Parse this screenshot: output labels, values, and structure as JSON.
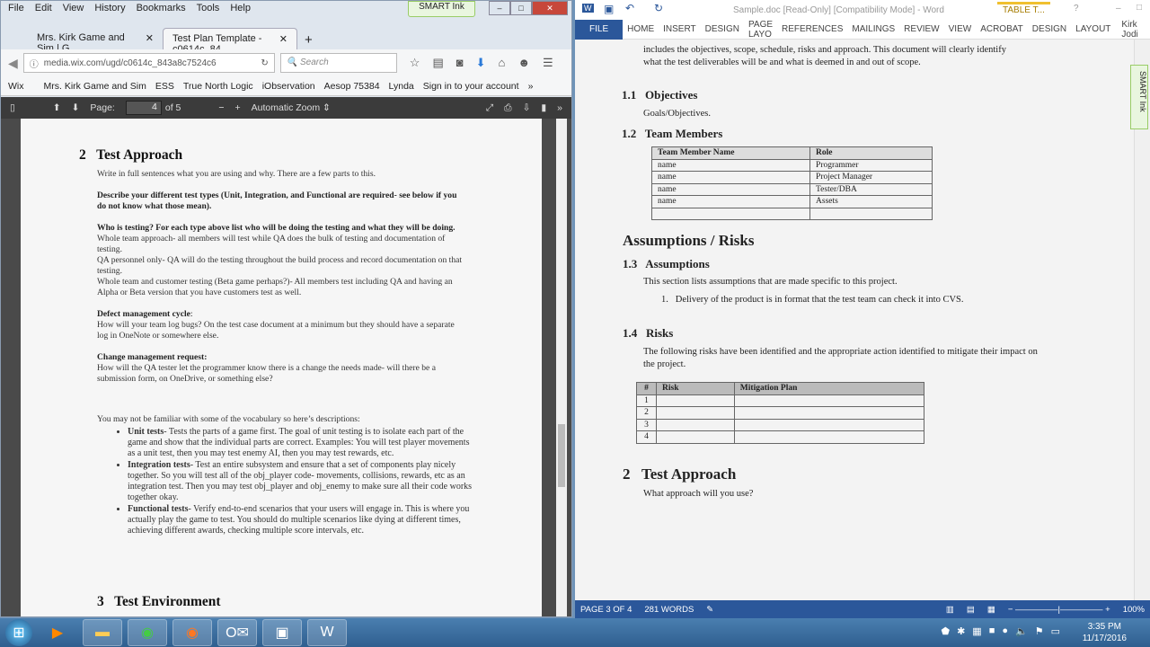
{
  "firefox": {
    "menu": [
      "File",
      "Edit",
      "View",
      "History",
      "Bookmarks",
      "Tools",
      "Help"
    ],
    "smart_ink": "SMART Ink",
    "tabs": [
      {
        "label": "Mrs. Kirk Game and Sim | G..."
      },
      {
        "label": "Test Plan Template - c0614c_84..."
      }
    ],
    "url": "media.wix.com/ugd/c0614c_843a8c7524c6",
    "search_placeholder": "Search",
    "bookmarks": [
      "Wix",
      "Mrs. Kirk Game and Sim",
      "ESS",
      "True North Logic",
      "iObservation",
      "Aesop 75384",
      "Lynda",
      "Sign in to your account"
    ],
    "pdf": {
      "page_label": "Page:",
      "page": "4",
      "of": "of 5",
      "zoom": "Automatic Zoom"
    },
    "doc": {
      "h_num": "2",
      "h_title": "Test Approach",
      "p1": "Write in full sentences what you are using and why.  There are a few parts to this.",
      "p2": "Describe your different test types (Unit, Integration, and Functional are required- see below if you do not know what those mean).",
      "p3b": "Who is testing?  For each type above list who will be doing the testing and what they will be doing.",
      "p3a": "Whole team approach- all members will test while QA does the bulk of testing and documentation of testing.",
      "p3c": "QA personnel only- QA will do the testing throughout the build process and record documentation on that testing.",
      "p3d": "Whole team and customer testing (Beta game perhaps?)- All members test including QA and having an Alpha or Beta version that you have customers test as well.",
      "p4b": "Defect management cycle",
      "p4": "How will your team log bugs?  On the test case document at a minimum but they should have a separate log in OneNote or somewhere else.",
      "p5b": "Change management request:",
      "p5": "How will the QA tester let the programmer know there is a change the needs made- will there be a submission form, on OneDrive, or something else?",
      "p6": "You may not be familiar with some of the vocabulary so here’s descriptions:",
      "bullets": [
        {
          "term": "Unit tests",
          "text": "- Tests the parts of a game first. The goal of unit testing is to isolate each part of the game and show that the individual parts are correct.  Examples: You will test player movements as a unit test, then you may test enemy AI, then you may test rewards, etc."
        },
        {
          "term": "Integration tests",
          "text": "- Test an entire subsystem and ensure that a set of components play nicely together. So you will test all of the obj_player code- movements, collisions, rewards, etc as an integration test.  Then you may test obj_player and obj_enemy to make sure all their code works together okay."
        },
        {
          "term": "Functional tests",
          "text": "- Verify end-to-end scenarios that your users will engage in. This is where you actually play the game to test.  You should do multiple scenarios like dying at different times, achieving different awards, checking multiple score intervals, etc."
        }
      ],
      "h3_num": "3",
      "h3_title": "Test Environment"
    }
  },
  "word": {
    "title": "Sample.doc [Read-Only] [Compatibility Mode] - Word",
    "table_tools": "TABLE T...",
    "tabs": [
      "FILE",
      "HOME",
      "INSERT",
      "DESIGN",
      "PAGE LAYO",
      "REFERENCES",
      "MAILINGS",
      "REVIEW",
      "VIEW",
      "ACROBAT",
      "DESIGN",
      "LAYOUT"
    ],
    "user": "Kirk Jodi",
    "doc": {
      "intro": "includes the objectives, scope, schedule, risks and approach.  This document will clearly identify what the test deliverables will be and what is deemed in and out of scope.",
      "s11": "1.1",
      "s11t": "Objectives",
      "goals": "Goals/Objectives.",
      "s12": "1.2",
      "s12t": "Team Members",
      "team_headers": [
        "Team Member Name",
        "Role"
      ],
      "team_rows": [
        [
          "name",
          "Programmer"
        ],
        [
          "name",
          "Project Manager"
        ],
        [
          "name",
          "Tester/DBA"
        ],
        [
          "name",
          "Assets"
        ],
        [
          "",
          ""
        ]
      ],
      "assump": "Assumptions / Risks",
      "s13": "1.3",
      "s13t": "Assumptions",
      "a1": "This section lists assumptions that are made specific to this project.",
      "a_item_num": "1.",
      "a_item": "Delivery of the product is in format that the test team can check it into CVS.",
      "s14": "1.4",
      "s14t": "Risks",
      "r1": "The following risks have been identified and the appropriate action identified to mitigate their impact on the project.",
      "risk_headers": [
        "#",
        "Risk",
        "Mitigation Plan"
      ],
      "risk_rows": [
        [
          "1",
          "",
          ""
        ],
        [
          "2",
          "",
          ""
        ],
        [
          "3",
          "",
          ""
        ],
        [
          "4",
          "",
          ""
        ]
      ],
      "s2": "2",
      "s2t": "Test Approach",
      "s2p": "What approach will you use?"
    },
    "status": {
      "page": "PAGE 3 OF 4",
      "words": "281 WORDS",
      "zoom": "100%"
    }
  },
  "taskbar": {
    "time": "3:35 PM",
    "date": "11/17/2016"
  }
}
